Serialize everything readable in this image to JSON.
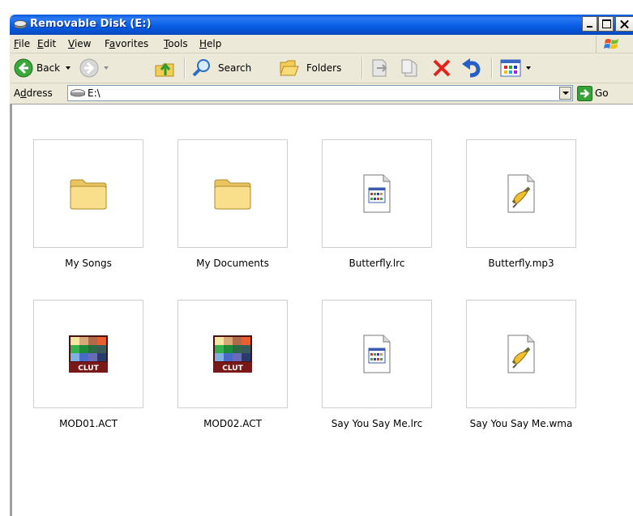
{
  "window": {
    "title": "Removable Disk (E:)"
  },
  "menu": [
    {
      "pre": "",
      "key": "F",
      "post": "ile"
    },
    {
      "pre": "",
      "key": "E",
      "post": "dit"
    },
    {
      "pre": "",
      "key": "V",
      "post": "iew"
    },
    {
      "pre": "F",
      "key": "a",
      "post": "vorites"
    },
    {
      "pre": "",
      "key": "T",
      "post": "ools"
    },
    {
      "pre": "",
      "key": "H",
      "post": "elp"
    }
  ],
  "toolbar": {
    "back_label": "Back",
    "search_label": "Search",
    "folders_label": "Folders"
  },
  "address": {
    "label_pre": "A",
    "label_key": "d",
    "label_post": "dress",
    "value": "E:\\",
    "go_label": "Go"
  },
  "files": [
    {
      "name": "My Songs",
      "type": "folder"
    },
    {
      "name": "My Documents",
      "type": "folder"
    },
    {
      "name": "Butterfly.lrc",
      "type": "lrc"
    },
    {
      "name": "Butterfly.mp3",
      "type": "media"
    },
    {
      "name": "MOD01.ACT",
      "type": "clut",
      "badge": "CLUT"
    },
    {
      "name": "MOD02.ACT",
      "type": "clut",
      "badge": "CLUT"
    },
    {
      "name": "Say You Say Me.lrc",
      "type": "lrc"
    },
    {
      "name": "Say You Say Me.wma",
      "type": "media"
    }
  ]
}
